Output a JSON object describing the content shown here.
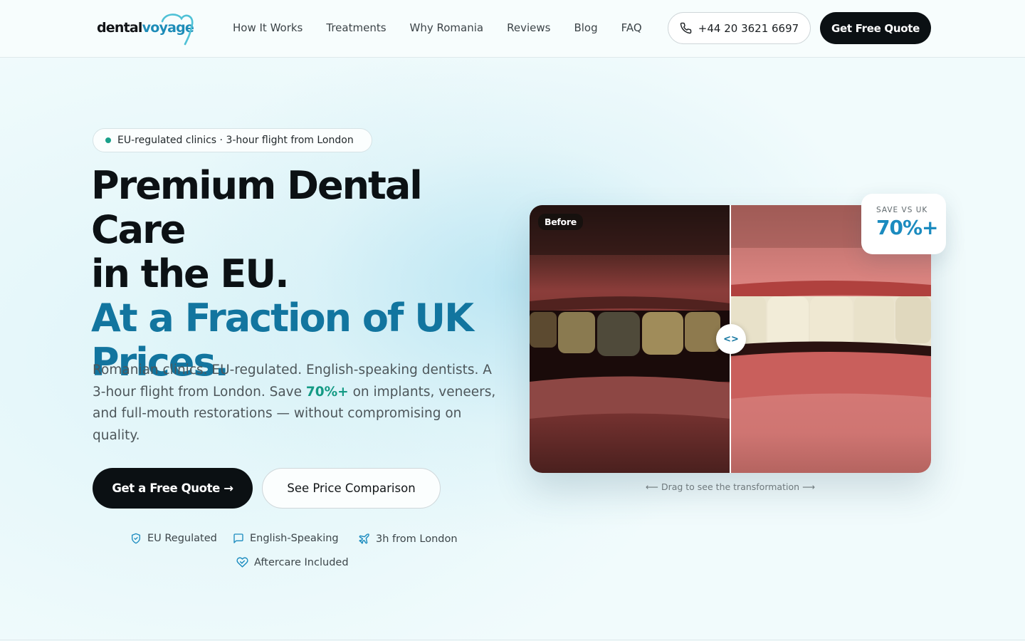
{
  "header": {
    "logo": {
      "part1": "dental",
      "part2": "voyage"
    },
    "nav": [
      "How It Works",
      "Treatments",
      "Why Romania",
      "Reviews",
      "Blog",
      "FAQ"
    ],
    "phone": "+44 20 3621 6697",
    "cta": "Get Free Quote"
  },
  "hero": {
    "badge": "EU-regulated clinics · 3-hour flight from London",
    "title_line1": "Premium Dental Care",
    "title_line2": "in the EU.",
    "title_accent1": "At a Fraction of UK",
    "title_accent2": "Prices.",
    "lead_before": "Romanian clinics. EU-regulated. English-speaking dentists. A 3-hour flight from London. Save ",
    "lead_highlight": "70%+",
    "lead_after": " on implants, veneers, and full-mouth restorations — without compromising on quality.",
    "cta_primary": "Get a Free Quote →",
    "cta_secondary": "See Price Comparison",
    "trust": [
      "EU Regulated",
      "English-Speaking",
      "3h from London",
      "Aftercare Included"
    ]
  },
  "comparison": {
    "before_label": "Before",
    "handle_label": "<>",
    "save_label": "SAVE VS UK",
    "save_value": "70%+",
    "drag_hint": "⟵ Drag to see the transformation ⟶"
  },
  "colors": {
    "brand_dark": "#0b1013",
    "brand_teal": "#12759f",
    "accent_green": "#149a84",
    "background": "#f1fbfc"
  },
  "icons": [
    "phone-icon",
    "shield-check-icon",
    "chat-icon",
    "plane-icon",
    "heart-icon"
  ]
}
